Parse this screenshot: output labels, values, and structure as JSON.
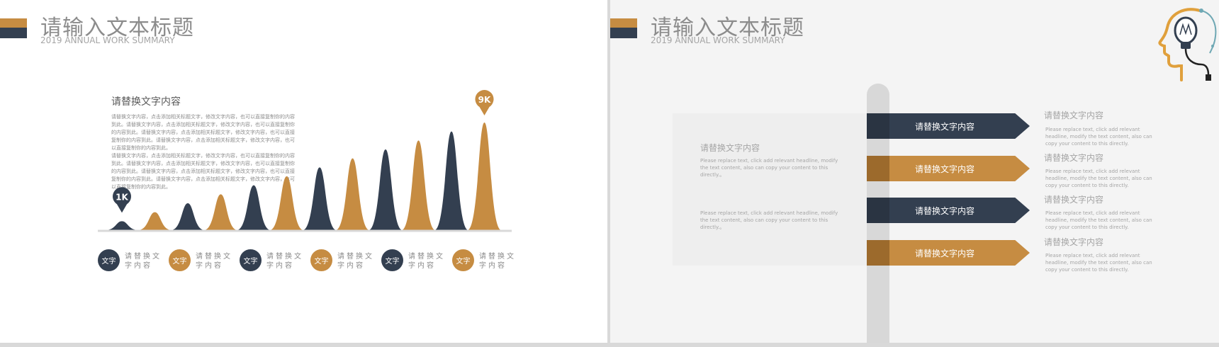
{
  "left_slide": {
    "title": "请输入文本标题",
    "subtitle": "2019 ANNUAL WORK SUMMARY",
    "text_heading": "请替换文字内容",
    "text_paragraphs": [
      "请替换文字内容，点击添加相关标题文字，修改文字内容，也可以直接复制你的内容到此。请替换文字内容，点击添加相关标题文字，修改文字内容，也可以直接复制你的内容到此。请替换文字内容，点击添加相关标题文字，修改文字内容，也可以直接复制你的内容到此。请替换文字内容，点击添加相关标题文字，修改文字内容，也可以直接复制你的内容到此。",
      "请替换文字内容，点击添加相关标题文字，修改文字内容，也可以直接复制你的内容到此。请替换文字内容，点击添加相关标题文字，修改文字内容，也可以直接复制你的内容到此。请替换文字内容，点击添加相关标题文字，修改文字内容，也可以直接复制你的内容到此。请替换文字内容，点击添加相关标题文字，修改文字内容，也可以直接复制你的内容到此。"
    ],
    "peak_levels": [
      1,
      2,
      3,
      4,
      5,
      6,
      7,
      8,
      9,
      10,
      11,
      12
    ],
    "pin_min_label": "1K",
    "pin_max_label": "9K",
    "legend": [
      {
        "circle": "文字",
        "text": "请替换文字内容"
      },
      {
        "circle": "文字",
        "text": "请替换文字内容"
      },
      {
        "circle": "文字",
        "text": "请替换文字内容"
      },
      {
        "circle": "文字",
        "text": "请替换文字内容"
      },
      {
        "circle": "文字",
        "text": "请替换文字内容"
      },
      {
        "circle": "文字",
        "text": "请替换文字内容"
      }
    ]
  },
  "right_slide": {
    "title": "请输入文本标题",
    "subtitle": "2019 ANNUAL WORK SUMMARY",
    "panel_heading": "请替换文字内容",
    "panel_text_1": "Please replace text, click add relevant headline, modify the text content, also can copy your content to this directly.。",
    "panel_text_2": "Please replace text, click add relevant headline, modify the text content, also can copy your content to this directly.。",
    "arrows": [
      "请替换文字内容",
      "请替换文字内容",
      "请替换文字内容",
      "请替换文字内容"
    ],
    "items": [
      {
        "heading": "请替换文字内容",
        "text": "Please replace text, click add relevant headline, modify the text content, also can copy your content to this directly."
      },
      {
        "heading": "请替换文字内容",
        "text": "Please replace text, click add relevant headline, modify the text content, also can copy your content to this directly."
      },
      {
        "heading": "请替换文字内容",
        "text": "Please replace text, click add relevant headline, modify the text content, also can copy your content to this directly."
      },
      {
        "heading": "请替换文字内容",
        "text": "Please replace text, click add relevant headline, modify the text content, also can copy your content to this directly."
      }
    ]
  },
  "colors": {
    "navy": "#333f50",
    "orange": "#c68c42",
    "title_gray": "#8c8c8c"
  },
  "icons": {
    "decoration": "head-lightbulb-icon"
  }
}
